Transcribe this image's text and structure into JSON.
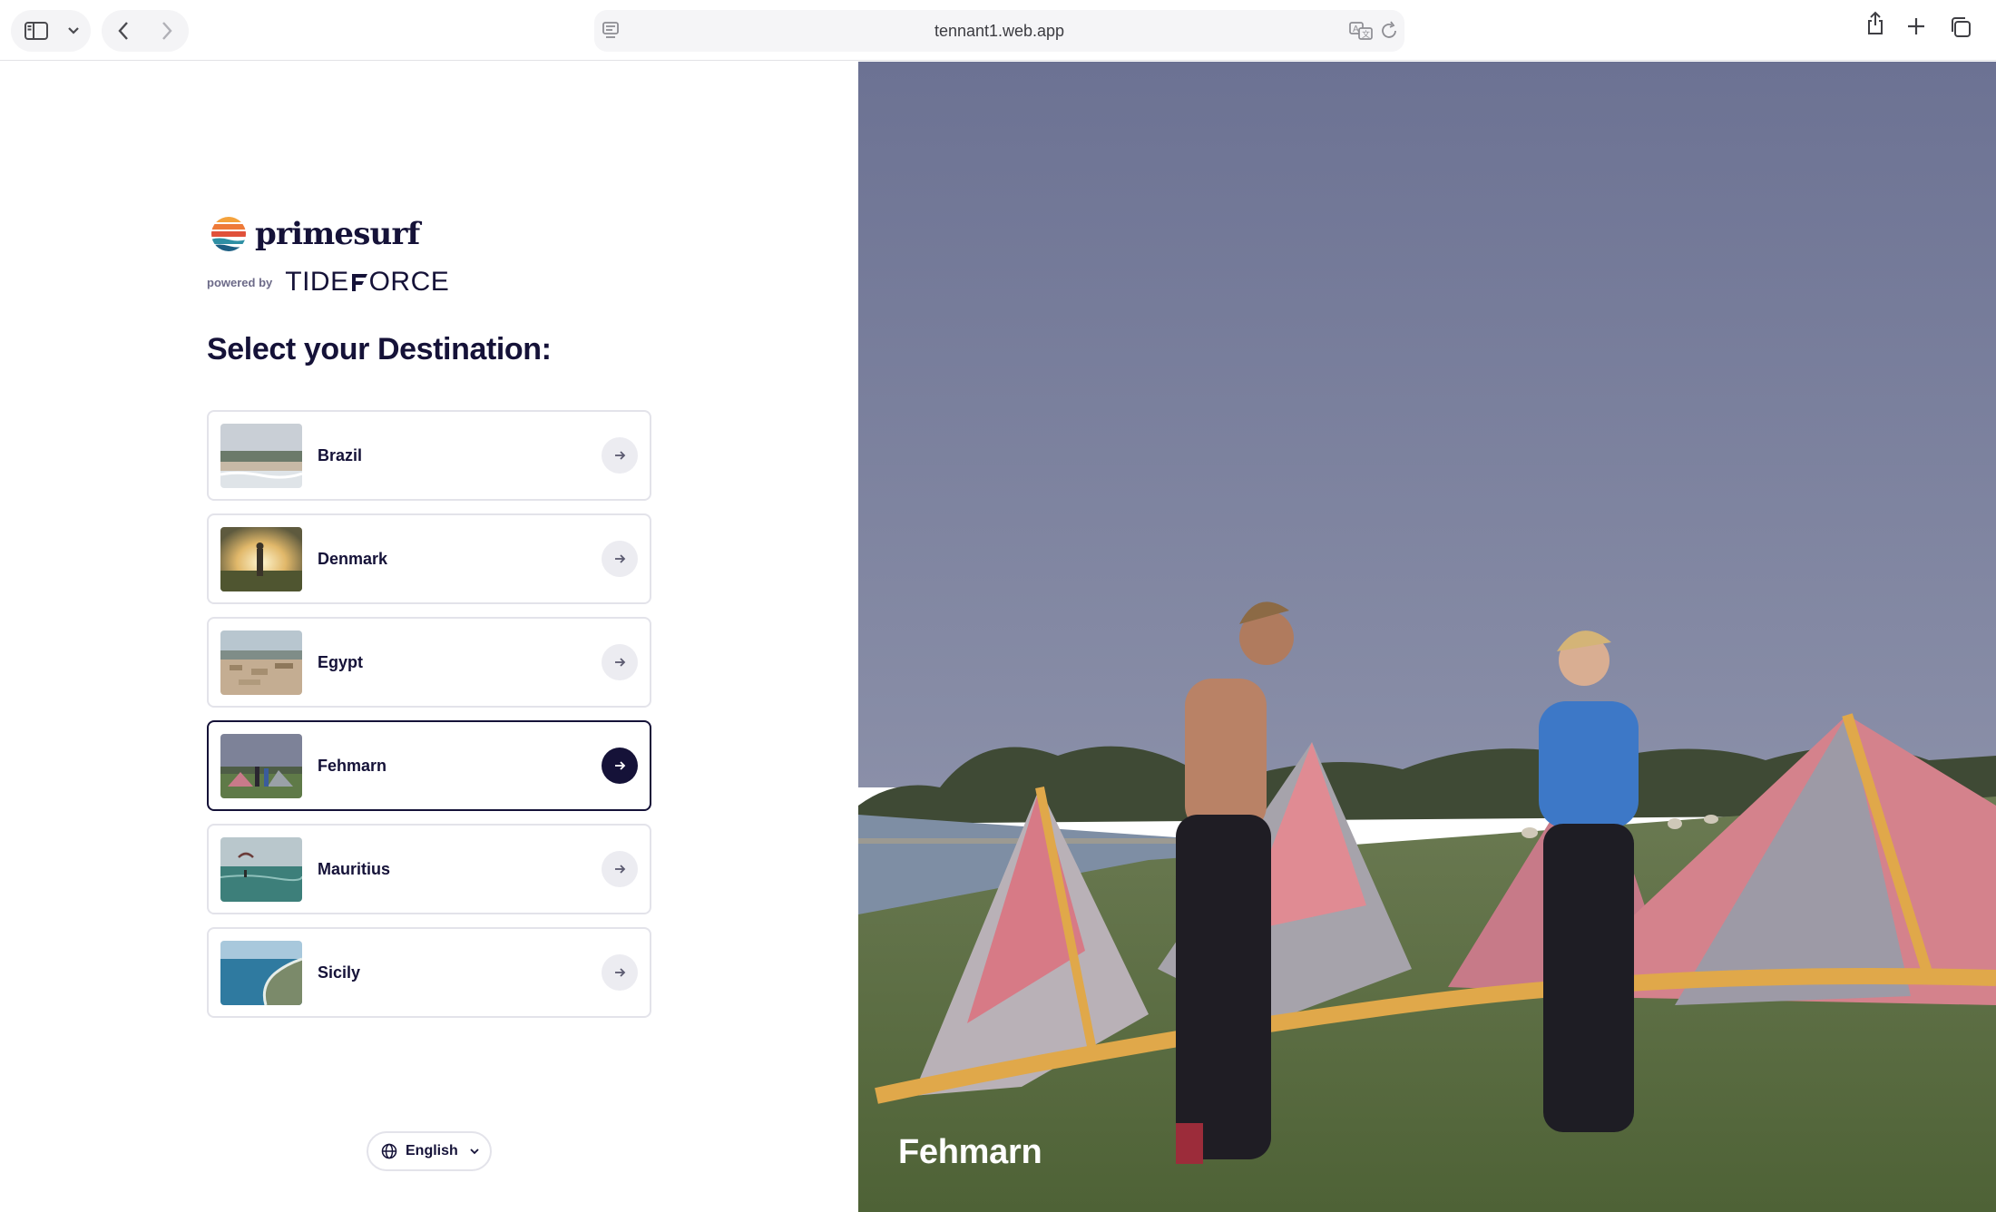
{
  "browser": {
    "url": "tennant1.web.app"
  },
  "brand": {
    "name": "primesurf",
    "powered_by": "powered by",
    "partner_left": "TIDE",
    "partner_right": "ORCE"
  },
  "page": {
    "heading": "Select your Destination:"
  },
  "destinations": [
    {
      "name": "Brazil",
      "active": false
    },
    {
      "name": "Denmark",
      "active": false
    },
    {
      "name": "Egypt",
      "active": false
    },
    {
      "name": "Fehmarn",
      "active": true
    },
    {
      "name": "Mauritius",
      "active": false
    },
    {
      "name": "Sicily",
      "active": false
    }
  ],
  "language": {
    "label": "English"
  },
  "hero": {
    "title": "Fehmarn"
  },
  "colors": {
    "primary": "#151238",
    "border": "#e3e3ea"
  },
  "icons": {
    "sidebar": "sidebar-icon",
    "back": "chevron-left-icon",
    "forward": "chevron-right-icon",
    "reader": "reader-icon",
    "translate": "translate-icon",
    "reload": "reload-icon",
    "share": "share-icon",
    "new_tab": "plus-icon",
    "tabs": "tabs-icon",
    "globe": "globe-icon",
    "arrow": "arrow-right-icon"
  }
}
